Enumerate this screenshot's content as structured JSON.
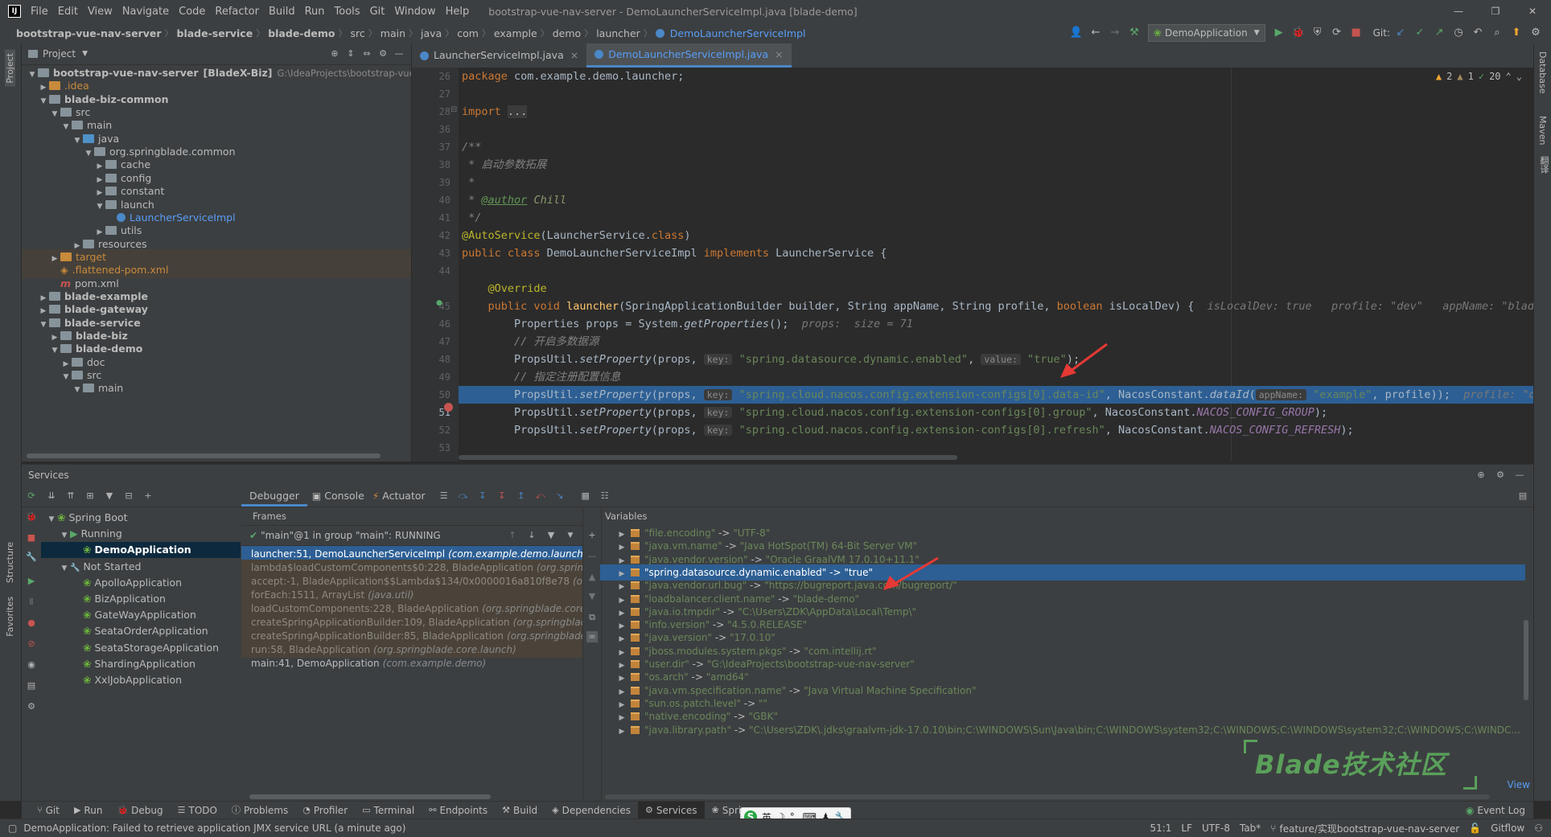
{
  "menu": {
    "items": [
      "File",
      "Edit",
      "View",
      "Navigate",
      "Code",
      "Refactor",
      "Build",
      "Run",
      "Tools",
      "Git",
      "Window",
      "Help"
    ],
    "window_title": "bootstrap-vue-nav-server - DemoLauncherServiceImpl.java [blade-demo]"
  },
  "breadcrumb": [
    "bootstrap-vue-nav-server",
    "blade-service",
    "blade-demo",
    "src",
    "main",
    "java",
    "com",
    "example",
    "demo",
    "launcher",
    "DemoLauncherServiceImpl"
  ],
  "toolbar": {
    "run_config": "DemoApplication",
    "git_label": "Git:"
  },
  "project": {
    "title": "Project",
    "tree": [
      {
        "label": "bootstrap-vue-nav-server",
        "suffix": "[BladeX-Biz]",
        "path": "G:\\IdeaProjects\\bootstrap-vue-nav",
        "depth": 0,
        "icon": "folder"
      },
      {
        "label": ".idea",
        "depth": 1,
        "icon": "folder",
        "color": "orange"
      },
      {
        "label": "blade-biz-common",
        "depth": 1,
        "icon": "module",
        "bold": true
      },
      {
        "label": "src",
        "depth": 2,
        "icon": "folder"
      },
      {
        "label": "main",
        "depth": 3,
        "icon": "folder"
      },
      {
        "label": "java",
        "depth": 4,
        "icon": "folder-blue"
      },
      {
        "label": "org.springblade.common",
        "depth": 5,
        "icon": "package"
      },
      {
        "label": "cache",
        "depth": 6,
        "icon": "package"
      },
      {
        "label": "config",
        "depth": 6,
        "icon": "package"
      },
      {
        "label": "constant",
        "depth": 6,
        "icon": "package"
      },
      {
        "label": "launch",
        "depth": 6,
        "icon": "package"
      },
      {
        "label": "LauncherServiceImpl",
        "depth": 7,
        "icon": "class",
        "color": "blue"
      },
      {
        "label": "utils",
        "depth": 6,
        "icon": "package"
      },
      {
        "label": "resources",
        "depth": 4,
        "icon": "folder"
      },
      {
        "label": "target",
        "depth": 2,
        "icon": "folder-orange",
        "color": "orange"
      },
      {
        "label": ".flattened-pom.xml",
        "depth": 2,
        "icon": "xml",
        "color": "orange"
      },
      {
        "label": "pom.xml",
        "depth": 2,
        "icon": "maven"
      },
      {
        "label": "blade-example",
        "depth": 1,
        "icon": "module",
        "bold": true
      },
      {
        "label": "blade-gateway",
        "depth": 1,
        "icon": "module",
        "bold": true
      },
      {
        "label": "blade-service",
        "depth": 1,
        "icon": "module",
        "bold": true
      },
      {
        "label": "blade-biz",
        "depth": 2,
        "icon": "module",
        "bold": true
      },
      {
        "label": "blade-demo",
        "depth": 2,
        "icon": "module",
        "bold": true
      },
      {
        "label": "doc",
        "depth": 3,
        "icon": "folder"
      },
      {
        "label": "src",
        "depth": 3,
        "icon": "folder"
      },
      {
        "label": "main",
        "depth": 4,
        "icon": "folder"
      }
    ]
  },
  "editor": {
    "tabs": [
      {
        "label": "LauncherServiceImpl.java",
        "active": false
      },
      {
        "label": "DemoLauncherServiceImpl.java",
        "active": true
      }
    ],
    "inspections": {
      "warnings": "2",
      "weak": "1",
      "ok": "20"
    },
    "line_numbers": [
      "26",
      "27",
      "28",
      "36",
      "37",
      "38",
      "39",
      "40",
      "41",
      "42",
      "43",
      "44",
      "",
      "45",
      "46",
      "47",
      "48",
      "49",
      "50",
      "51",
      "52",
      "53"
    ]
  },
  "services": {
    "title": "Services",
    "tree": [
      {
        "label": "Spring Boot",
        "depth": 0
      },
      {
        "label": "Running",
        "depth": 1
      },
      {
        "label": "DemoApplication",
        "depth": 2,
        "selected": true
      },
      {
        "label": "Not Started",
        "depth": 1
      },
      {
        "label": "ApolloApplication",
        "depth": 2
      },
      {
        "label": "BizApplication",
        "depth": 2
      },
      {
        "label": "GateWayApplication",
        "depth": 2
      },
      {
        "label": "SeataOrderApplication",
        "depth": 2
      },
      {
        "label": "SeataStorageApplication",
        "depth": 2
      },
      {
        "label": "ShardingApplication",
        "depth": 2
      },
      {
        "label": "XxlJobApplication",
        "depth": 2
      }
    ]
  },
  "debugger": {
    "tabs": [
      "Debugger",
      "Console",
      "Actuator"
    ],
    "frames_title": "Frames",
    "variables_title": "Variables",
    "thread": "\"main\"@1 in group \"main\": RUNNING",
    "frames": [
      {
        "method": "launcher:51, DemoLauncherServiceImpl",
        "location": "(com.example.demo.launcher)",
        "selected": true
      },
      {
        "method": "lambda$loadCustomComponents$0:228, BladeApplication",
        "location": "(org.spring",
        "lib": true
      },
      {
        "method": "accept:-1, BladeApplication$$Lambda$134/0x0000016a810f8e78",
        "location": "(org.",
        "lib": true
      },
      {
        "method": "forEach:1511, ArrayList",
        "location": "(java.util)",
        "lib": true
      },
      {
        "method": "loadCustomComponents:228, BladeApplication",
        "location": "(org.springblade.core",
        "lib": true
      },
      {
        "method": "createSpringApplicationBuilder:109, BladeApplication",
        "location": "(org.springblad",
        "lib": true
      },
      {
        "method": "createSpringApplicationBuilder:85, BladeApplication",
        "location": "(org.springblade.",
        "lib": true
      },
      {
        "method": "run:58, BladeApplication",
        "location": "(org.springblade.core.launch)",
        "lib": true
      },
      {
        "method": "main:41, DemoApplication",
        "location": "(com.example.demo)",
        "lib": false
      }
    ],
    "variables": [
      {
        "key": "\"file.encoding\"",
        "value": "\"UTF-8\""
      },
      {
        "key": "\"java.vm.name\"",
        "value": "\"Java HotSpot(TM) 64-Bit Server VM\""
      },
      {
        "key": "\"java.vendor.version\"",
        "value": "\"Oracle GraalVM 17.0.10+11.1\""
      },
      {
        "key": "\"spring.datasource.dynamic.enabled\"",
        "value": "\"true\"",
        "selected": true
      },
      {
        "key": "\"java.vendor.url.bug\"",
        "value": "\"https://bugreport.java.com/bugreport/\""
      },
      {
        "key": "\"loadbalancer.client.name\"",
        "value": "\"blade-demo\""
      },
      {
        "key": "\"java.io.tmpdir\"",
        "value": "\"C:\\Users\\ZDK\\AppData\\Local\\Temp\\\""
      },
      {
        "key": "\"info.version\"",
        "value": "\"4.5.0.RELEASE\""
      },
      {
        "key": "\"java.version\"",
        "value": "\"17.0.10\""
      },
      {
        "key": "\"jboss.modules.system.pkgs\"",
        "value": "\"com.intellij.rt\""
      },
      {
        "key": "\"user.dir\"",
        "value": "\"G:\\IdeaProjects\\bootstrap-vue-nav-server\""
      },
      {
        "key": "\"os.arch\"",
        "value": "\"amd64\""
      },
      {
        "key": "\"java.vm.specification.name\"",
        "value": "\"Java Virtual Machine Specification\""
      },
      {
        "key": "\"sun.os.patch.level\"",
        "value": "\"\""
      },
      {
        "key": "\"native.encoding\"",
        "value": "\"GBK\""
      },
      {
        "key": "\"java.library.path\"",
        "value": "\"C:\\Users\\ZDK\\.jdks\\graalvm-jdk-17.0.10\\bin;C:\\WINDOWS\\Sun\\Java\\bin;C:\\WINDOWS\\system32;C:\\WINDOWS;C:\\WINDOWS\\system32;C:\\WINDOWS;C:\\WINDC..."
      }
    ],
    "view_link": "View"
  },
  "toolwindows": [
    "Git",
    "Run",
    "Debug",
    "TODO",
    "Problems",
    "Profiler",
    "Terminal",
    "Endpoints",
    "Build",
    "Dependencies",
    "Services",
    "Spring"
  ],
  "event_log": "Event Log",
  "watermark": "Blade技术社区",
  "left_stripe": {
    "project": "Project",
    "structure": "Structure",
    "favorites": "Favorites"
  },
  "right_stripe": {
    "database": "Database",
    "maven": "Maven",
    "translate": "翻译"
  },
  "ime": {
    "lang": "英"
  },
  "status": {
    "message": "DemoApplication: Failed to retrieve application JMX service URL (a minute ago)",
    "position": "51:1",
    "line_sep": "LF",
    "encoding": "UTF-8",
    "indent": "Tab*",
    "branch": "feature/实现bootstrap-vue-nav-server",
    "gitflow": "Gitflow"
  },
  "colors": {
    "accent": "#4a88c7",
    "selection": "#2d5f94",
    "arrow": "#e53935"
  }
}
